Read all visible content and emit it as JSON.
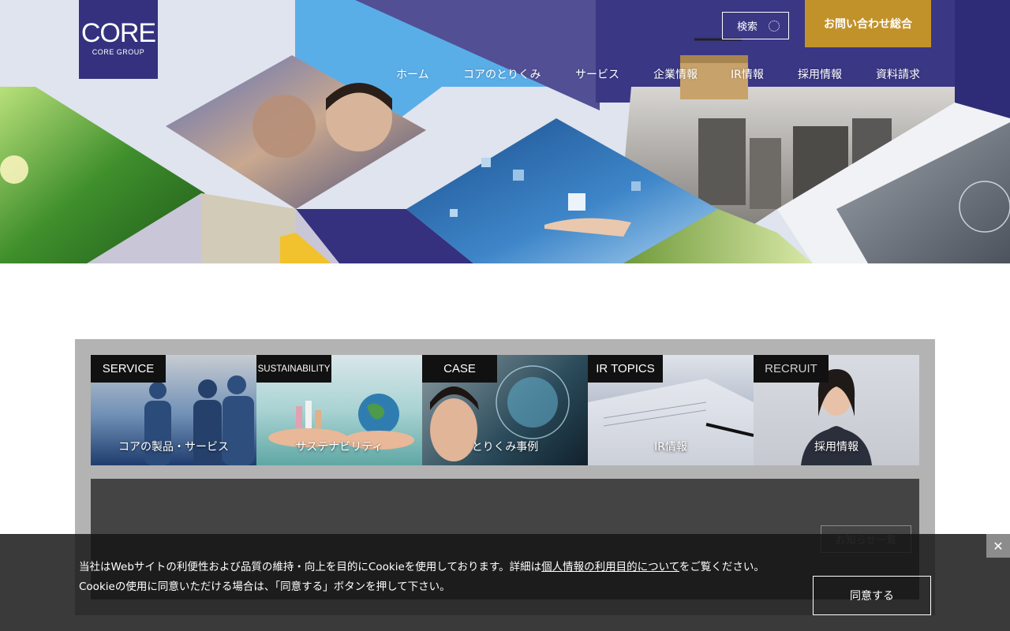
{
  "logo": {
    "main": "CORE",
    "sub": "CORE GROUP"
  },
  "header": {
    "search_label": "検索",
    "contact_label": "お問い合わせ総合"
  },
  "nav": [
    {
      "label": "ホーム"
    },
    {
      "label": "コアのとりくみ"
    },
    {
      "label": "サービス"
    },
    {
      "label": "企業情報"
    },
    {
      "label": "IR情報"
    },
    {
      "label": "採用情報"
    },
    {
      "label": "資料請求"
    }
  ],
  "cards": [
    {
      "tag": "SERVICE",
      "label": "コアの製品・サービス"
    },
    {
      "tag": "SUSTAINABILITY",
      "label": "サステナビリティ"
    },
    {
      "tag": "CASE",
      "label": "とりくみ事例"
    },
    {
      "tag": "IR TOPICS",
      "label": "IR情報"
    },
    {
      "tag": "RECRUIT",
      "label": "採用情報"
    }
  ],
  "news": {
    "more_label": "お知らせ一覧"
  },
  "cookie": {
    "text_before": "当社はWebサイトの利便性および品質の維持・向上を目的にCookieを使用しております。詳細は",
    "link": "個人情報の利用目的について",
    "text_after": "をご覧ください。",
    "line2": "Cookieの使用に同意いただける場合は、「同意する」ボタンを押して下さい。",
    "agree_label": "同意する",
    "close_symbol": "✕"
  },
  "colors": {
    "brand_navy": "#35317f",
    "accent_gold": "#c2922a",
    "sky_blue": "#5aaee8",
    "panel_gray": "#b3b3b3",
    "news_dark": "#444444"
  }
}
